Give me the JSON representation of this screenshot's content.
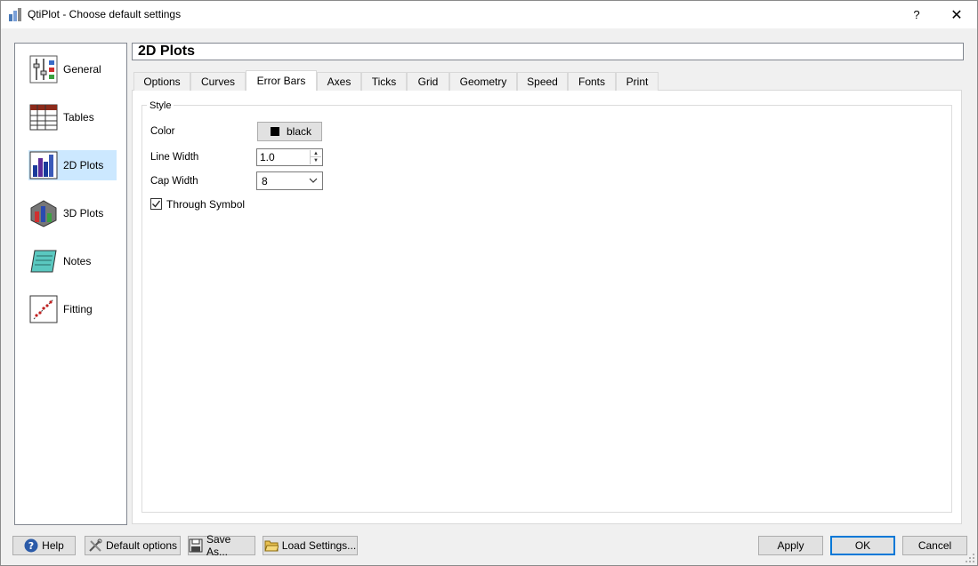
{
  "window": {
    "title": "QtiPlot - Choose default settings",
    "help_button": "?",
    "close_button": "✕"
  },
  "sidebar": {
    "items": [
      {
        "label": "General",
        "icon": "general-settings-icon"
      },
      {
        "label": "Tables",
        "icon": "table-icon"
      },
      {
        "label": "2D Plots",
        "icon": "bar-chart-icon",
        "selected": true
      },
      {
        "label": "3D Plots",
        "icon": "3d-chart-icon"
      },
      {
        "label": "Notes",
        "icon": "notes-icon"
      },
      {
        "label": "Fitting",
        "icon": "fitting-icon"
      }
    ]
  },
  "page": {
    "header": "2D Plots",
    "tabs": [
      "Options",
      "Curves",
      "Error Bars",
      "Axes",
      "Ticks",
      "Grid",
      "Geometry",
      "Speed",
      "Fonts",
      "Print"
    ],
    "active_tab": "Error Bars"
  },
  "style_group": {
    "title": "Style",
    "color_label": "Color",
    "color_value": "black",
    "color_hex": "#000000",
    "line_width_label": "Line Width",
    "line_width_value": "1.0",
    "cap_width_label": "Cap Width",
    "cap_width_value": "8",
    "through_symbol_label": "Through Symbol",
    "through_symbol_checked": true
  },
  "buttons": {
    "help": "Help",
    "default_options": "Default options",
    "save_as": "Save As...",
    "load_settings": "Load Settings...",
    "apply": "Apply",
    "ok": "OK",
    "cancel": "Cancel"
  },
  "colors": {
    "selected_item": "#cce8ff",
    "default_button_border": "#0078d7"
  }
}
